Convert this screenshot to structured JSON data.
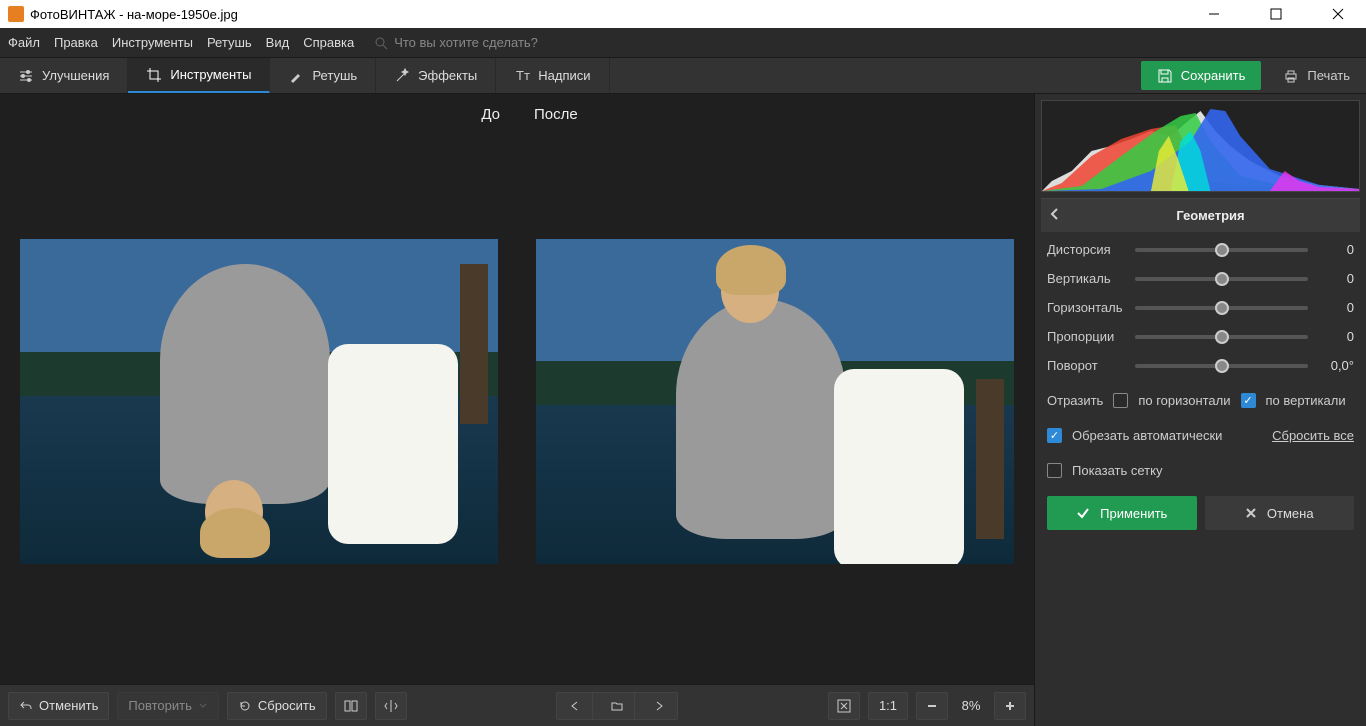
{
  "title": "ФотоВИНТАЖ - на-море-1950e.jpg",
  "menu": [
    "Файл",
    "Правка",
    "Инструменты",
    "Ретушь",
    "Вид",
    "Справка"
  ],
  "search_placeholder": "Что вы хотите сделать?",
  "tabs": {
    "enhance": "Улучшения",
    "tools": "Инструменты",
    "retouch": "Ретушь",
    "effects": "Эффекты",
    "text": "Надписи"
  },
  "save": "Сохранить",
  "print": "Печать",
  "pane_before": "До",
  "pane_after": "После",
  "bottom": {
    "undo": "Отменить",
    "redo": "Повторить",
    "reset": "Сбросить",
    "ratio": "1:1",
    "zoom": "8%"
  },
  "panel": {
    "title": "Геометрия",
    "sliders": [
      {
        "label": "Дисторсия",
        "value": "0"
      },
      {
        "label": "Вертикаль",
        "value": "0"
      },
      {
        "label": "Горизонталь",
        "value": "0"
      },
      {
        "label": "Пропорции",
        "value": "0"
      },
      {
        "label": "Поворот",
        "value": "0,0°"
      }
    ],
    "reflect": "Отразить",
    "flip_h": "по горизонтали",
    "flip_v": "по вертикали",
    "auto_crop": "Обрезать автоматически",
    "show_grid": "Показать сетку",
    "reset_all": "Сбросить все",
    "apply": "Применить",
    "cancel": "Отмена"
  }
}
